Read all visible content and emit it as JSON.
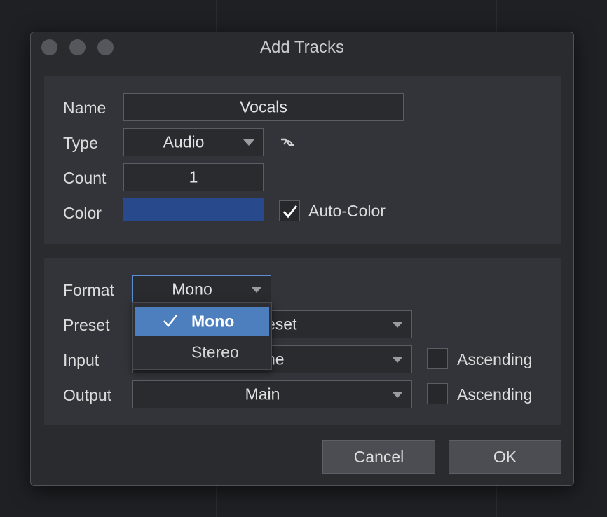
{
  "window": {
    "title": "Add Tracks"
  },
  "section1": {
    "name_label": "Name",
    "name_value": "Vocals",
    "type_label": "Type",
    "type_value": "Audio",
    "count_label": "Count",
    "count_value": "1",
    "color_label": "Color",
    "color_value": "#284a8c",
    "autocolor_label": "Auto-Color",
    "autocolor_checked": true,
    "type_icon": "audio-wave-icon"
  },
  "section2": {
    "format_label": "Format",
    "format_value": "Mono",
    "preset_label": "Preset",
    "preset_value_visible": "eset",
    "input_label": "Input",
    "input_value_visible": "ne",
    "input_ascending_label": "Ascending",
    "output_label": "Output",
    "output_value": "Main",
    "output_ascending_label": "Ascending"
  },
  "format_menu": {
    "items": [
      {
        "label": "Mono",
        "selected": true
      },
      {
        "label": "Stereo",
        "selected": false
      }
    ]
  },
  "buttons": {
    "cancel": "Cancel",
    "ok": "OK"
  },
  "colors": {
    "accent": "#4d7fbf",
    "focus_border": "#5b8fd0",
    "track_color": "#284a8c"
  }
}
